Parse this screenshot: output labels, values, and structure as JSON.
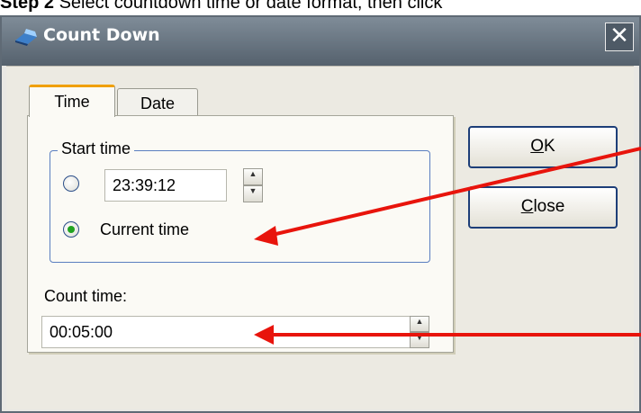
{
  "caption": {
    "step": "Step 2",
    "text": "Select countdown time or date format, then click"
  },
  "window": {
    "title": "Count Down",
    "close_glyph": "✕"
  },
  "tabs": [
    {
      "label": "Time",
      "active": true
    },
    {
      "label": "Date",
      "active": false
    }
  ],
  "start_time": {
    "legend": "Start time",
    "fixed_value": "23:39:12",
    "current_label": "Current time",
    "selected": "current"
  },
  "count_time": {
    "label": "Count time:",
    "value": "00:05:00"
  },
  "buttons": {
    "ok": "OK",
    "ok_mnemonic": "O",
    "ok_rest": "K",
    "close": "Close",
    "close_mnemonic": "C",
    "close_rest": "lose"
  },
  "colors": {
    "annotation_arrow": "#e8140c",
    "titlebar": "#6b7783",
    "radio_dot": "#21a321",
    "tab_accent": "#f0a000"
  },
  "icons": {
    "title": "count-down-app-icon",
    "spin_up": "spin-up-icon",
    "spin_down": "spin-down-icon"
  }
}
